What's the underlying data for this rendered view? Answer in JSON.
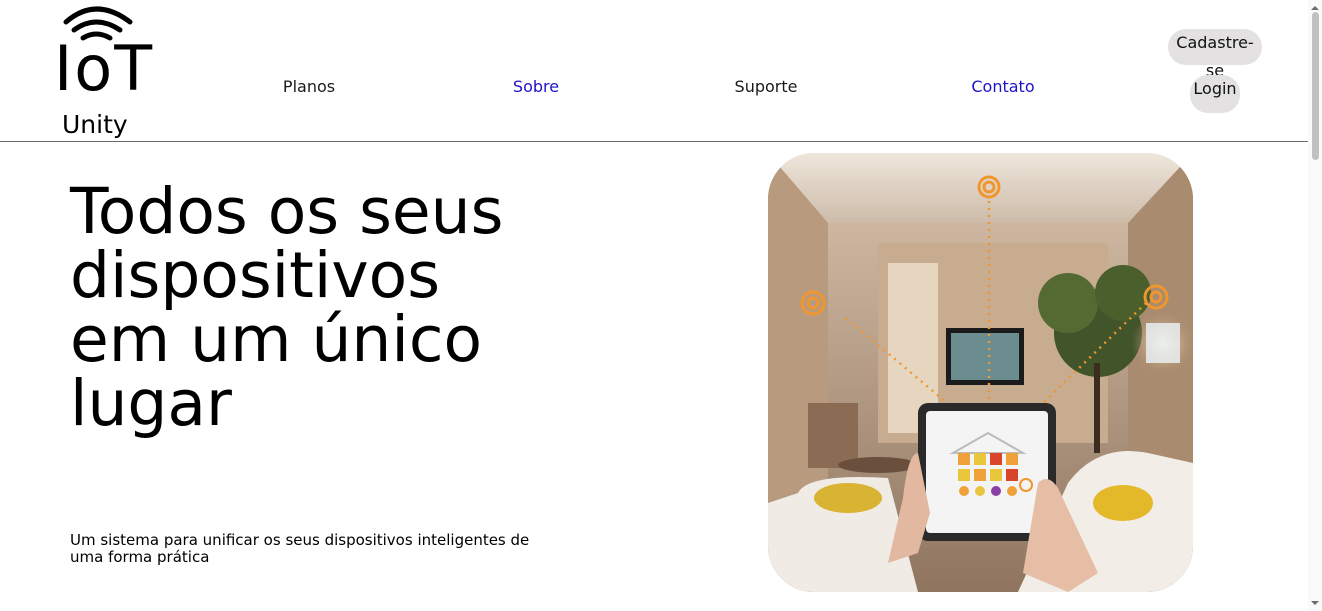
{
  "brand": {
    "logo_word": "IoT",
    "logo_sub": "Unity"
  },
  "nav": {
    "items": [
      {
        "label": "Planos",
        "color": "#1a1a1a"
      },
      {
        "label": "Sobre",
        "color": "#1f13c7"
      },
      {
        "label": "Suporte",
        "color": "#1a1a1a"
      },
      {
        "label": "Contato",
        "color": "#1f13c7"
      }
    ]
  },
  "auth": {
    "signup_label": "Cadastre-se",
    "login_label": "Login"
  },
  "hero": {
    "title": "Todos os seus dispositivos em um único lugar",
    "subtitle": "Um sistema para unificar os seus dispositivos inteligentes de uma forma prática",
    "image": "smart-home living room controlled by tablet"
  },
  "colors": {
    "button_bg": "#e3e1e1",
    "link_blue": "#1f13c7",
    "divider": "#6b6b6b",
    "accent_orange": "#f0962f"
  },
  "icons": [
    "wifi-icon",
    "scroll-up-icon",
    "scroll-down-icon"
  ]
}
